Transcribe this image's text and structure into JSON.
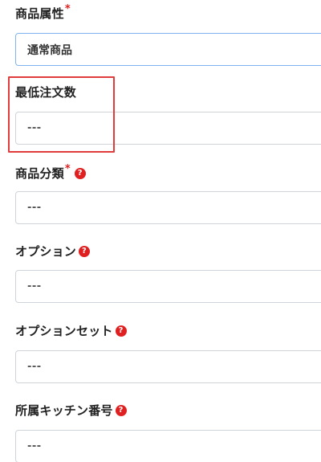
{
  "form": {
    "product_attribute": {
      "label": "商品属性",
      "required_mark": "*",
      "value": "通常商品"
    },
    "min_order_qty": {
      "label": "最低注文数",
      "placeholder": "---"
    },
    "product_category": {
      "label": "商品分類",
      "required_mark": "*",
      "help_glyph": "?",
      "placeholder": "---"
    },
    "option": {
      "label": "オプション",
      "help_glyph": "?",
      "placeholder": "---"
    },
    "option_set": {
      "label": "オプションセット",
      "help_glyph": "?",
      "placeholder": "---"
    },
    "kitchen_number": {
      "label": "所属キッチン番号",
      "help_glyph": "?",
      "placeholder": "---"
    }
  },
  "colors": {
    "required": "#e02020",
    "help_icon": "#e02020",
    "highlight_box": "#e03c3c",
    "active_border": "#80b4f0",
    "field_border": "#cfd4da"
  },
  "icons": {
    "help": "question-circle-icon"
  }
}
